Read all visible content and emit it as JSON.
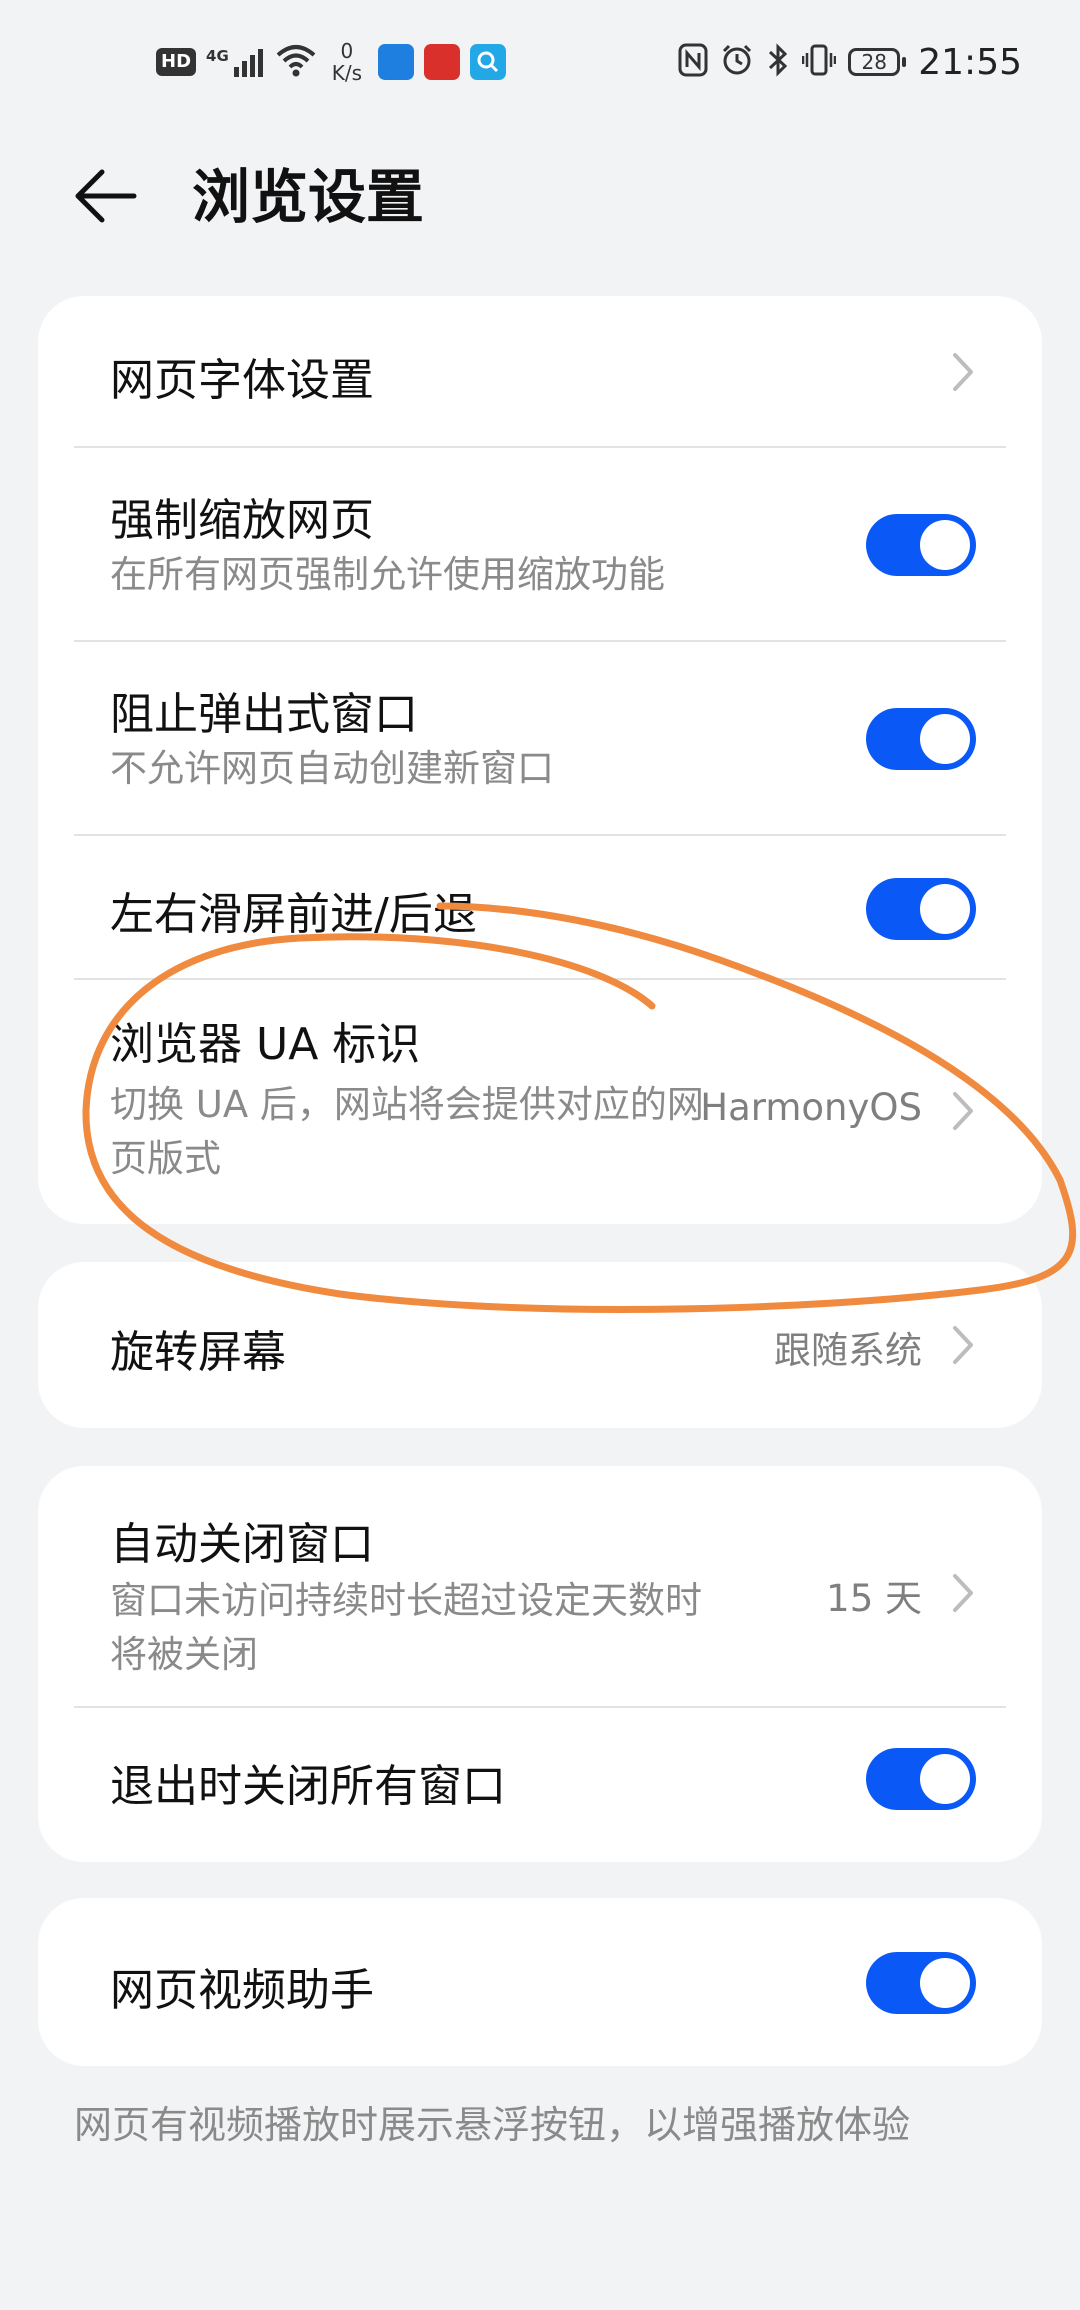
{
  "status_bar": {
    "hd_label": "HD",
    "network_label": "4G",
    "speed_value": "0",
    "speed_unit": "K/s",
    "left_icons": [
      "signal-icon",
      "wifi-icon",
      "app-notification-icon-1",
      "app-notification-icon-2",
      "search-app-icon"
    ],
    "right_icons": [
      "nfc-icon",
      "alarm-icon",
      "bluetooth-icon",
      "vibrate-icon"
    ],
    "battery_level": "28",
    "time": "21:55"
  },
  "header": {
    "title": "浏览设置",
    "back_icon": "arrow-left-icon"
  },
  "colors": {
    "accent": "#0a59f7",
    "background": "#f1f3f5",
    "card": "#ffffff",
    "annotation_stroke": "#f08a3e"
  },
  "group1": {
    "font_settings": {
      "title": "网页字体设置"
    },
    "force_zoom": {
      "title": "强制缩放网页",
      "subtitle": "在所有网页强制允许使用缩放功能",
      "enabled": true
    },
    "block_popups": {
      "title": "阻止弹出式窗口",
      "subtitle": "不允许网页自动创建新窗口",
      "enabled": true
    },
    "swipe_nav": {
      "title": "左右滑屏前进/后退",
      "enabled": true
    },
    "browser_ua": {
      "title": "浏览器 UA 标识",
      "subtitle": "切换 UA 后，网站将会提供对应的网页版式",
      "value": "HarmonyOS"
    }
  },
  "group2": {
    "rotate_screen": {
      "title": "旋转屏幕",
      "value": "跟随系统"
    }
  },
  "group3": {
    "auto_close": {
      "title": "自动关闭窗口",
      "subtitle": "窗口未访问持续时长超过设定天数时将被关闭",
      "value": "15 天"
    },
    "close_on_exit": {
      "title": "退出时关闭所有窗口",
      "enabled": true
    }
  },
  "group4": {
    "video_helper": {
      "title": "网页视频助手",
      "enabled": true
    },
    "footnote": "网页有视频播放时展示悬浮按钮，以增强播放体验"
  }
}
